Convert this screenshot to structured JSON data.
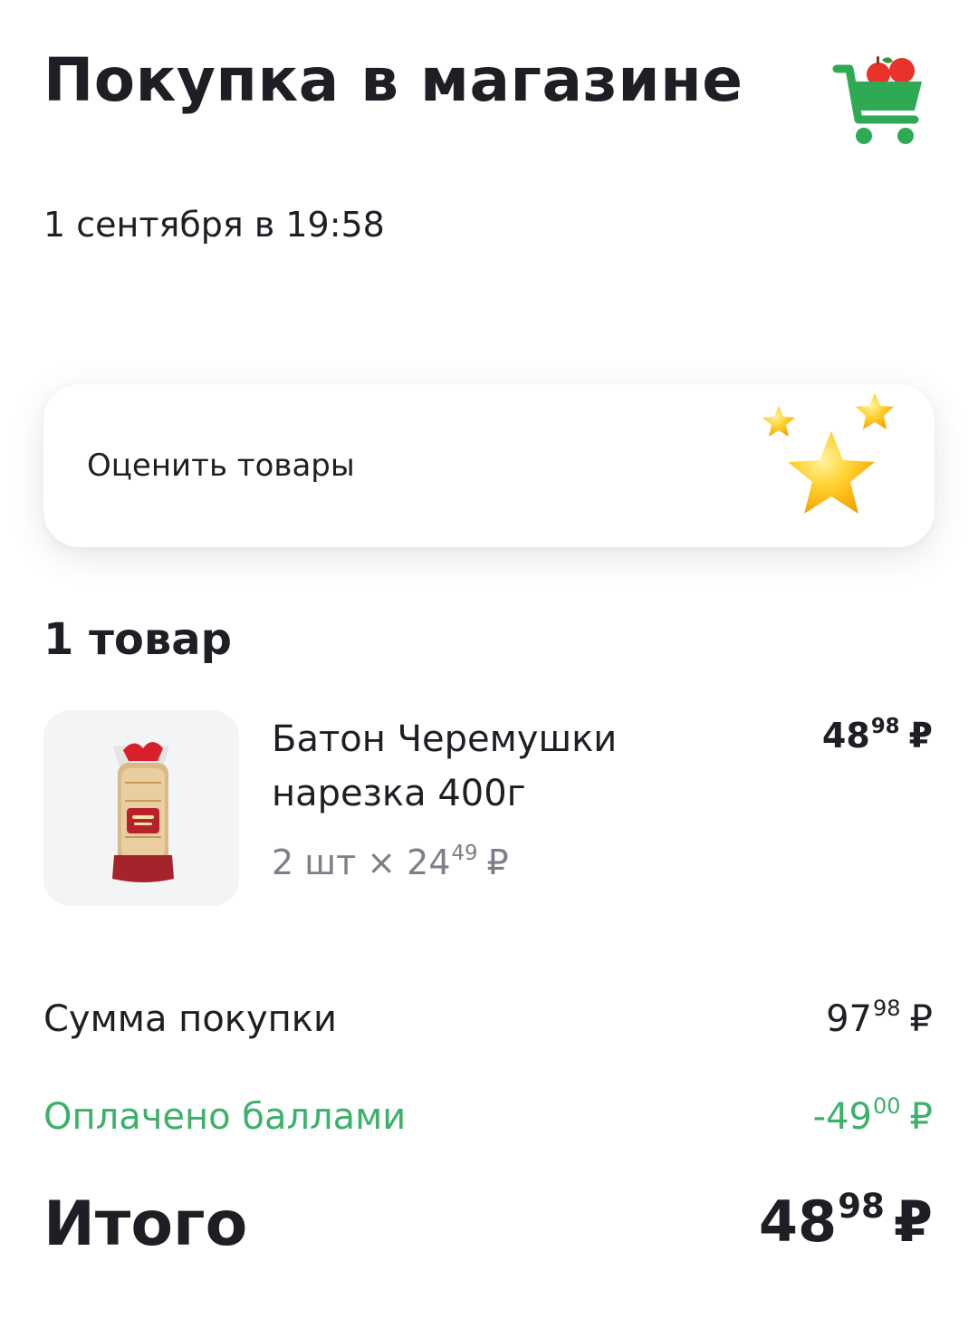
{
  "header": {
    "title": "Покупка в магазине",
    "icon": "shopping-cart-icon"
  },
  "date": "1 сентября в 19:58",
  "rate_card": {
    "label": "Оценить товары",
    "icon": "stars-icon"
  },
  "items_count": "1 товар",
  "items": [
    {
      "name": "Батон Черемушки нарезка 400г",
      "qty_prefix": "2 шт × ",
      "unit_price_int": "24",
      "unit_price_dec": "49",
      "total_int": "48",
      "total_dec": "98",
      "image_icon": "bread-loaf-icon"
    }
  ],
  "summary": {
    "sum_label": "Сумма покупки",
    "sum_int": "97",
    "sum_dec": "98",
    "bonus_label": "Оплачено баллами",
    "bonus_int": "-49",
    "bonus_dec": "00",
    "total_label": "Итого",
    "total_int": "48",
    "total_dec": "98"
  },
  "currency": "₽",
  "colors": {
    "accent_green": "#3bb16a",
    "text": "#1d1f24",
    "muted": "#7b7f87",
    "cart_green": "#2eaa54",
    "cart_red": "#e8322a"
  }
}
